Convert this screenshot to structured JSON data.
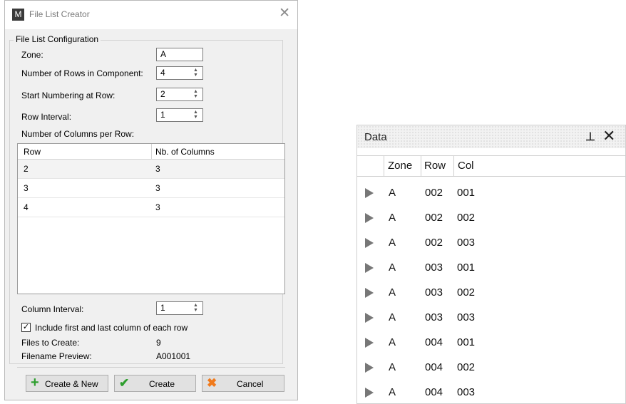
{
  "dialog": {
    "app_icon": "M",
    "title": "File List Creator",
    "close_glyph": "✕",
    "group_title": "File List Configuration",
    "zone": {
      "label": "Zone:",
      "value": "A"
    },
    "rows_in_component": {
      "label": "Number of Rows in Component:",
      "value": "4"
    },
    "start_row": {
      "label": "Start Numbering at Row:",
      "value": "2"
    },
    "row_interval": {
      "label": "Row Interval:",
      "value": "1"
    },
    "columns_per_row_label": "Number of Columns per Row:",
    "table": {
      "headers": [
        "Row",
        "Nb. of Columns"
      ],
      "rows": [
        {
          "row": "2",
          "cols": "3"
        },
        {
          "row": "3",
          "cols": "3"
        },
        {
          "row": "4",
          "cols": "3"
        }
      ]
    },
    "column_interval": {
      "label": "Column Interval:",
      "value": "1"
    },
    "include_checkbox": {
      "label": "Include first and last column of each row",
      "checked": true
    },
    "files_to_create": {
      "label": "Files to Create:",
      "value": "9"
    },
    "filename_preview": {
      "label": "Filename Preview:",
      "value": "A001001"
    },
    "buttons": {
      "create_new": "Create & New",
      "create": "Create",
      "cancel": "Cancel"
    },
    "colors": {
      "plus": "#2e9e2e",
      "check": "#2e9e2e",
      "cancel": "#f07a1c"
    }
  },
  "data_panel": {
    "title": "Data",
    "pin_glyph": "⊥",
    "close_glyph": "✕",
    "columns": [
      "Zone",
      "Row",
      "Col"
    ],
    "rows": [
      {
        "zone": "A",
        "row": "002",
        "col": "001"
      },
      {
        "zone": "A",
        "row": "002",
        "col": "002"
      },
      {
        "zone": "A",
        "row": "002",
        "col": "003"
      },
      {
        "zone": "A",
        "row": "003",
        "col": "001"
      },
      {
        "zone": "A",
        "row": "003",
        "col": "002"
      },
      {
        "zone": "A",
        "row": "003",
        "col": "003"
      },
      {
        "zone": "A",
        "row": "004",
        "col": "001"
      },
      {
        "zone": "A",
        "row": "004",
        "col": "002"
      },
      {
        "zone": "A",
        "row": "004",
        "col": "003"
      }
    ]
  }
}
